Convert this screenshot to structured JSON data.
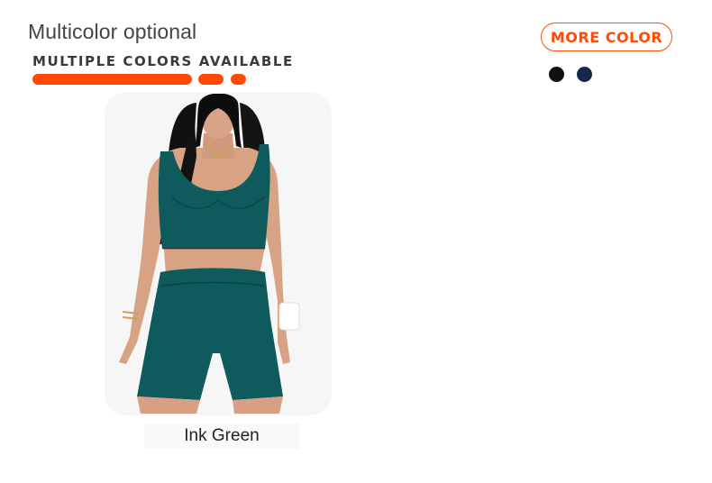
{
  "header": {
    "title": "Multicolor optional",
    "subtitle": "MULTIPLE COLORS AVAILABLE",
    "more_color_label": "MORE COLOR"
  },
  "colors": {
    "accent": "#ff4a08",
    "text": "#444444",
    "garment": "#0e5a5c",
    "swatches": [
      "#111111",
      "#16284a"
    ]
  },
  "product": {
    "color_name": "Ink Green",
    "image_subject": "model wearing seamless sports bra and shorts set"
  }
}
